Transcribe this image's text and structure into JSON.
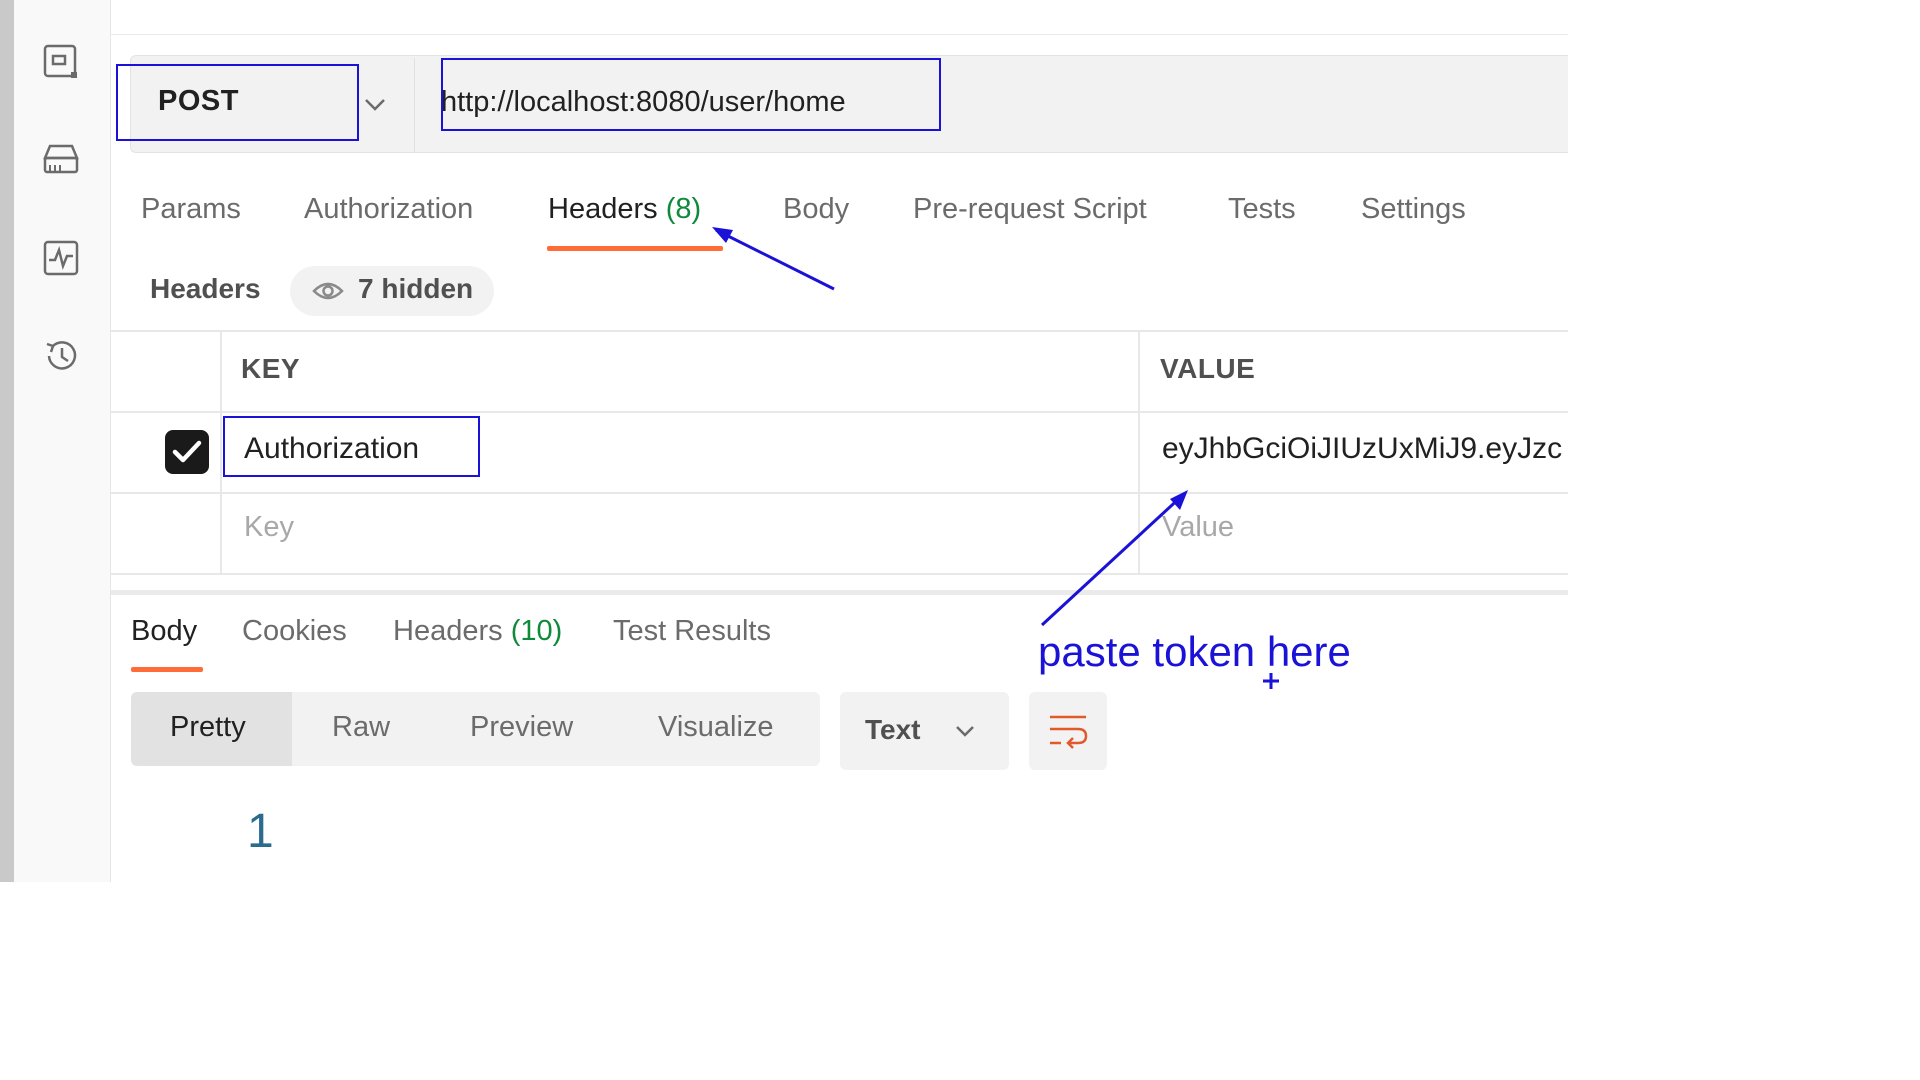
{
  "request": {
    "method": "POST",
    "url": "http://localhost:8080/user/home"
  },
  "request_tabs": {
    "params": "Params",
    "authorization": "Authorization",
    "headers": "Headers",
    "headers_count": "(8)",
    "body": "Body",
    "pre_request_script": "Pre-request Script",
    "tests": "Tests",
    "settings": "Settings"
  },
  "headers_panel": {
    "title": "Headers",
    "hidden_label": "7 hidden"
  },
  "headers_table": {
    "columns": {
      "key": "KEY",
      "value": "VALUE"
    },
    "rows": [
      {
        "checked": true,
        "key": "Authorization",
        "value": "eyJhbGciOiJIUzUxMiJ9.eyJzc"
      }
    ],
    "placeholder": {
      "key": "Key",
      "value": "Value"
    }
  },
  "response_tabs": {
    "body": "Body",
    "cookies": "Cookies",
    "headers": "Headers",
    "headers_count": "(10)",
    "test_results": "Test Results"
  },
  "response_view": {
    "modes": [
      "Pretty",
      "Raw",
      "Preview",
      "Visualize"
    ],
    "active_mode": "Pretty",
    "format": "Text",
    "line_number": "1"
  },
  "annotation": {
    "note": "paste token here"
  },
  "icons": {
    "sidebar": [
      "collections-icon",
      "environments-icon",
      "monitors-icon",
      "history-icon"
    ],
    "eye": "eye-icon",
    "wrap": "wrap-lines-icon"
  },
  "colors": {
    "accent": "#ff6c37",
    "count_green": "#0f8a3b",
    "annotation_blue": "#1a12d6"
  }
}
